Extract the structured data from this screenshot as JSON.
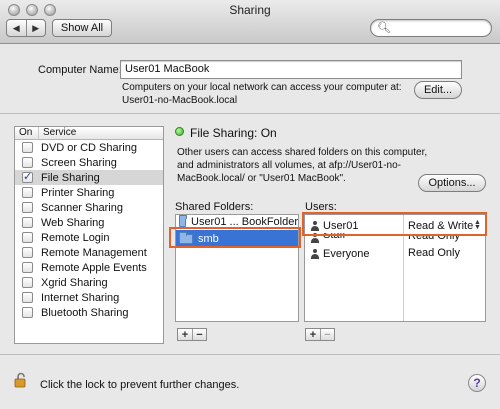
{
  "window": {
    "title": "Sharing"
  },
  "toolbar": {
    "back_glyph": "◀",
    "forward_glyph": "▶",
    "show_all_label": "Show All",
    "search_placeholder": ""
  },
  "computer": {
    "name_label": "Computer Name:",
    "name_value": "User01 MacBook",
    "note_line1": "Computers on your local network can access your computer at:",
    "note_line2": "User01-no-MacBook.local",
    "edit_label": "Edit..."
  },
  "services": {
    "header_on": "On",
    "header_service": "Service",
    "items": [
      {
        "label": "DVD or CD Sharing",
        "on": false
      },
      {
        "label": "Screen Sharing",
        "on": false
      },
      {
        "label": "File Sharing",
        "on": true
      },
      {
        "label": "Printer Sharing",
        "on": false
      },
      {
        "label": "Scanner Sharing",
        "on": false
      },
      {
        "label": "Web Sharing",
        "on": false
      },
      {
        "label": "Remote Login",
        "on": false
      },
      {
        "label": "Remote Management",
        "on": false
      },
      {
        "label": "Remote Apple Events",
        "on": false
      },
      {
        "label": "Xgrid Sharing",
        "on": false
      },
      {
        "label": "Internet Sharing",
        "on": false
      },
      {
        "label": "Bluetooth Sharing",
        "on": false
      }
    ],
    "selected_index": 2
  },
  "file_sharing": {
    "status": "File Sharing: On",
    "status_color": "#3fae2a",
    "desc_line1": "Other users can access shared folders on this computer,",
    "desc_line2": "and administrators all volumes, at afp://User01-no-",
    "desc_line3": "MacBook.local/ or \"User01 MacBook\".",
    "options_label": "Options...",
    "shared_folders_label": "Shared Folders:",
    "users_label": "Users:",
    "folders": [
      {
        "name": "User01 ... BookFolder"
      },
      {
        "name": "smb"
      }
    ],
    "users": [
      {
        "name": "User01",
        "permission": "Read & Write"
      },
      {
        "name": "Staff",
        "permission": "Read Only"
      },
      {
        "name": "Everyone",
        "permission": "Read Only"
      }
    ]
  },
  "footer": {
    "lock_text": "Click the lock to prevent further changes.",
    "help_label": "?"
  },
  "colors": {
    "selection_blue": "#3a73d6",
    "highlight_orange": "#e2622e"
  }
}
